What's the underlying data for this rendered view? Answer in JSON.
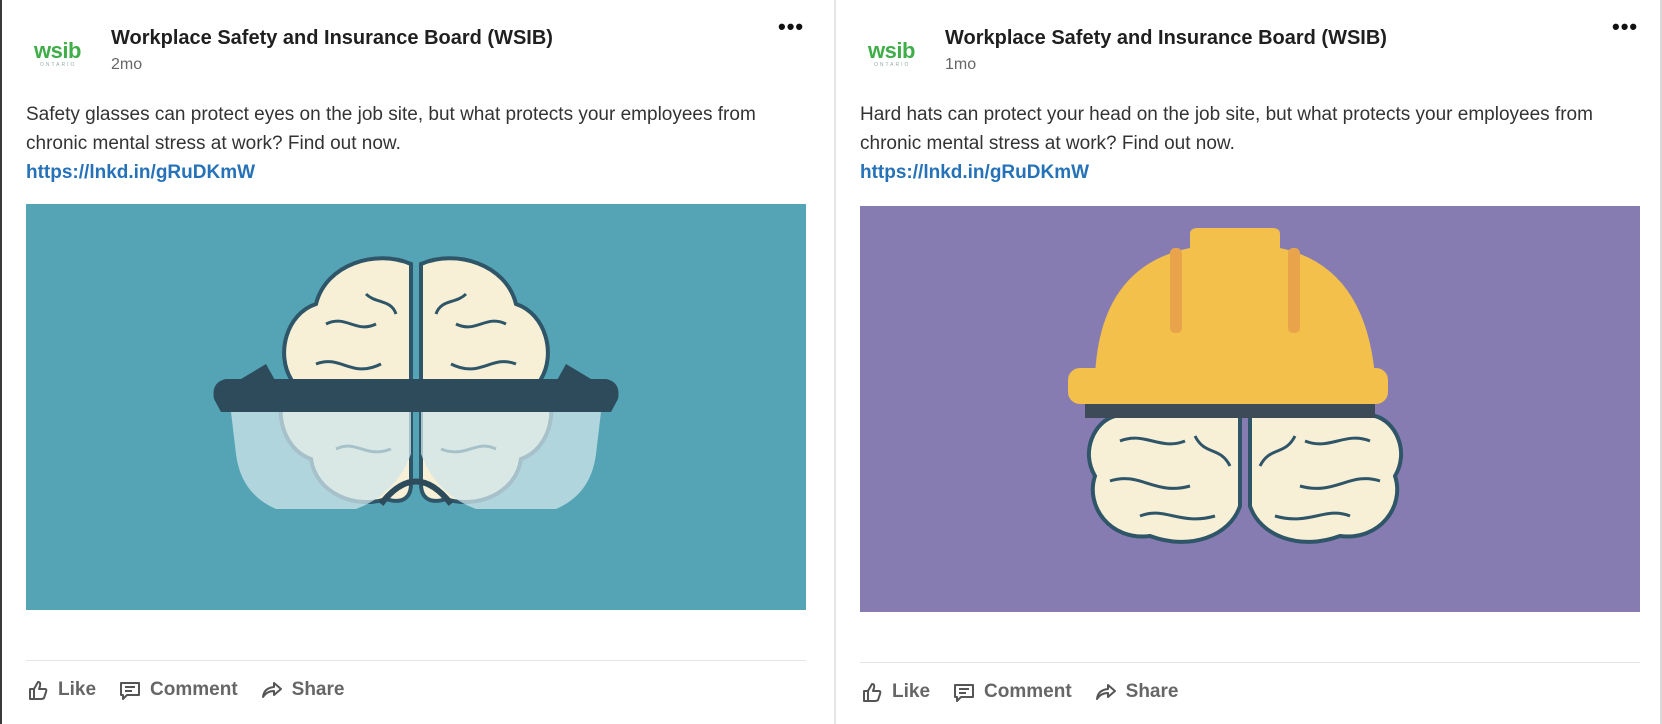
{
  "posts": [
    {
      "author": "Workplace Safety and Insurance Board (WSIB)",
      "logo_word": "wsib",
      "logo_sub": "ONTARIO",
      "time": "2mo",
      "more_label": "•••",
      "text": "Safety glasses can protect eyes on the job site, but what protects your employees from chronic mental stress at work? Find out now.",
      "link": "https://lnkd.in/gRuDKmW",
      "image": {
        "subject": "brain wearing safety glasses",
        "background": "#55a4b5"
      },
      "actions": {
        "like": "Like",
        "comment": "Comment",
        "share": "Share"
      }
    },
    {
      "author": "Workplace Safety and Insurance Board (WSIB)",
      "logo_word": "wsib",
      "logo_sub": "ONTARIO",
      "time": "1mo",
      "more_label": "•••",
      "text": "Hard hats can protect your head on the job site, but what protects your employees from chronic mental stress at work? Find out now.",
      "link": "https://lnkd.in/gRuDKmW",
      "image": {
        "subject": "brain wearing a yellow hard hat",
        "background": "#877cb2"
      },
      "actions": {
        "like": "Like",
        "comment": "Comment",
        "share": "Share"
      }
    }
  ],
  "colors": {
    "brand_green": "#3fae49",
    "link_blue": "#2672b8",
    "hat_yellow": "#f2c04b",
    "brain_cream": "#f7f0d6",
    "outline_dark": "#2f5568"
  }
}
